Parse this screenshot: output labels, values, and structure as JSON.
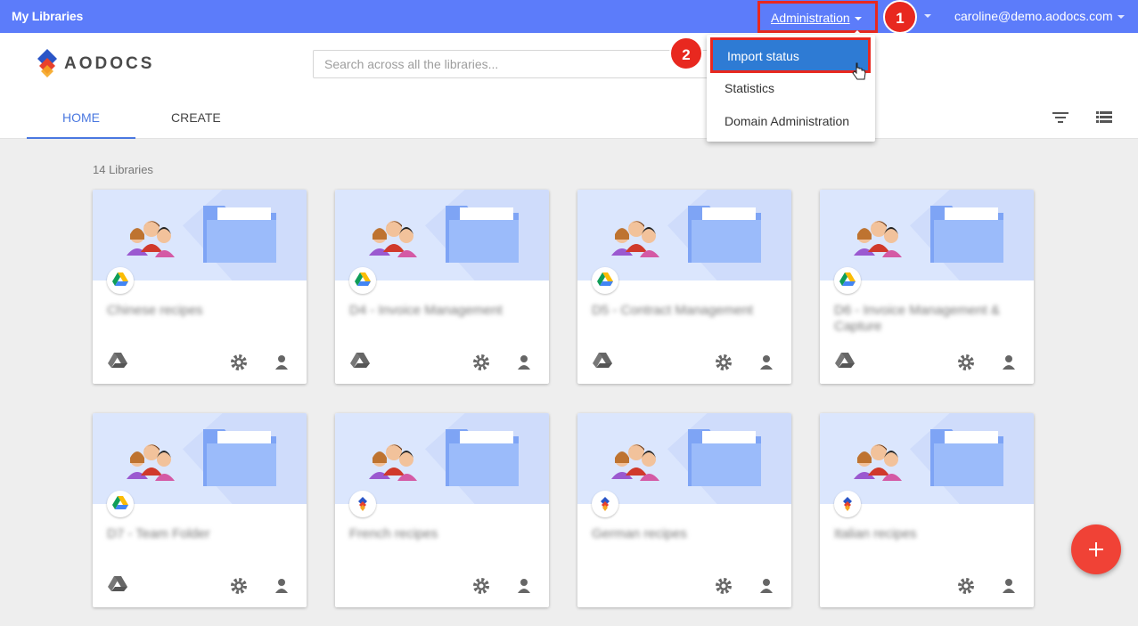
{
  "topbar": {
    "title": "My Libraries",
    "admin_label": "Administration",
    "user": "caroline@demo.aodocs.com",
    "badge1": "1",
    "badge2": "2"
  },
  "logo_text": "AODOCS",
  "search": {
    "placeholder": "Search across all the libraries..."
  },
  "tabs": {
    "home": "HOME",
    "create": "CREATE"
  },
  "admin_menu": {
    "items": [
      "Import status",
      "Statistics",
      "Domain Administration"
    ]
  },
  "library_count": "14 Libraries",
  "libraries": [
    {
      "name": "Chinese recipes",
      "source": "drive-icon",
      "has_drive_action": true
    },
    {
      "name": "D4 - Invoice Management",
      "source": "drive-icon",
      "has_drive_action": true
    },
    {
      "name": "D5 - Contract Management",
      "source": "drive-icon",
      "has_drive_action": true
    },
    {
      "name": "D6 - Invoice Management & Capture",
      "source": "drive-icon",
      "has_drive_action": true
    },
    {
      "name": "D7 - Team Folder",
      "source": "drive-icon",
      "has_drive_action": true
    },
    {
      "name": "French recipes",
      "source": "aodocs-icon",
      "has_drive_action": false
    },
    {
      "name": "German recipes",
      "source": "aodocs-icon",
      "has_drive_action": false
    },
    {
      "name": "Italian recipes",
      "source": "aodocs-icon",
      "has_drive_action": false
    }
  ],
  "colors": {
    "topbar": "#5c7cfa",
    "accent": "#4a78e0",
    "highlight": "#e8281f",
    "fab": "#f04236"
  }
}
